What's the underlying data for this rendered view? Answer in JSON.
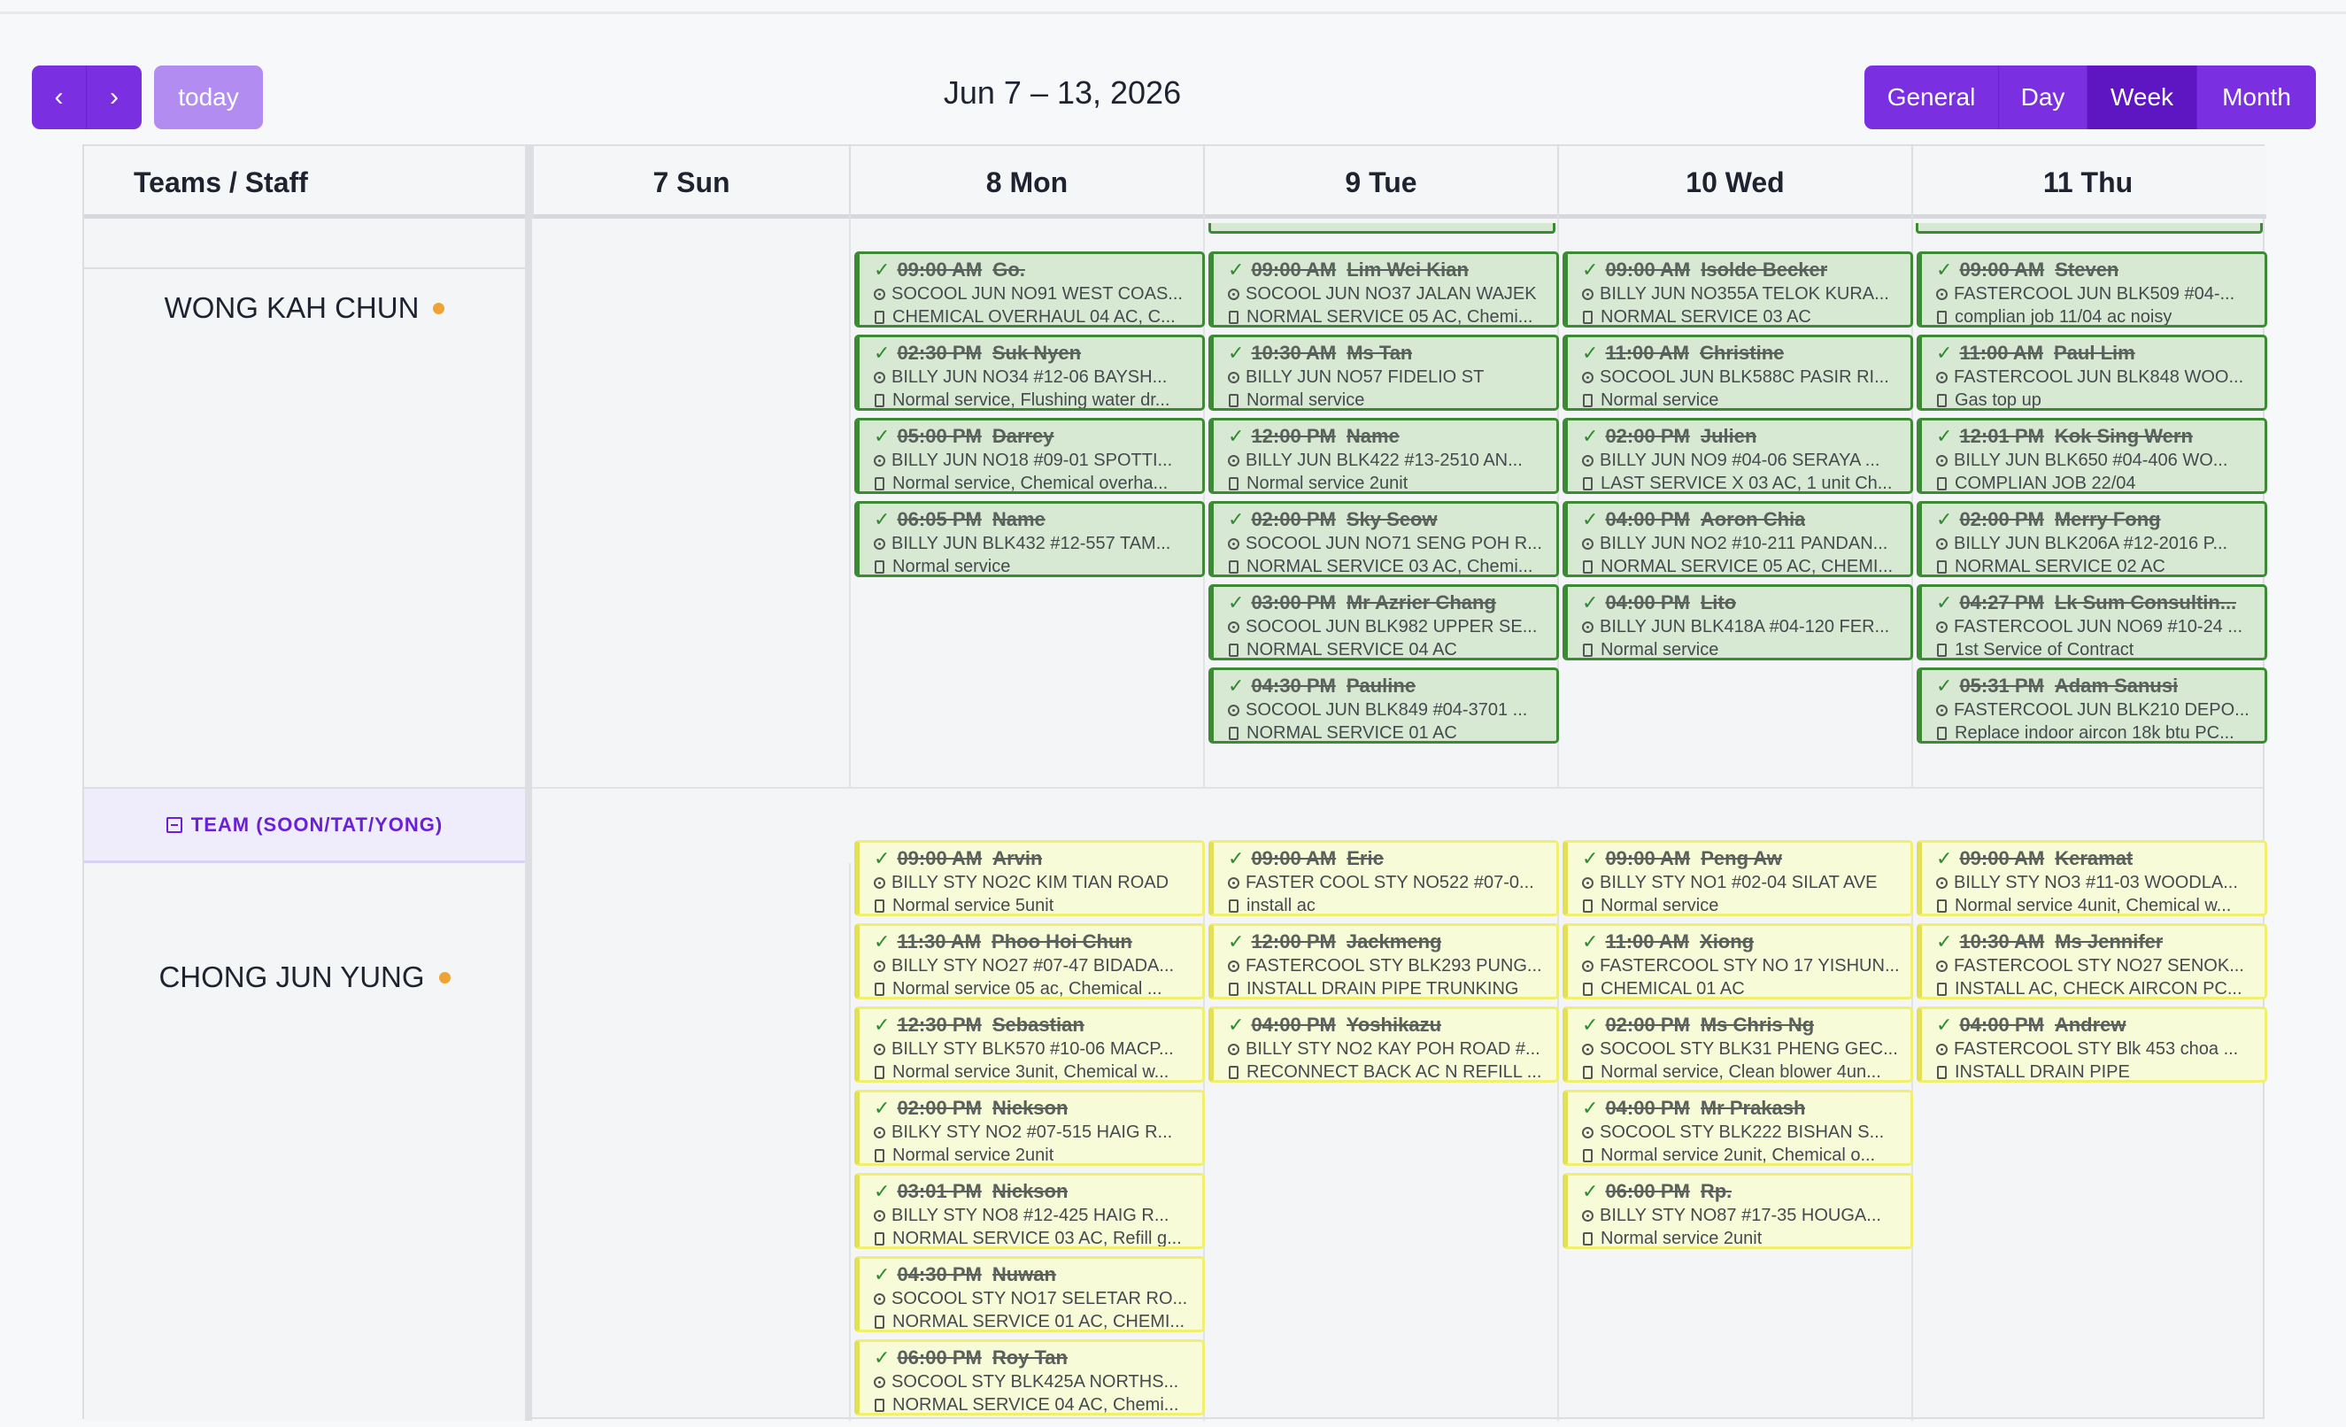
{
  "toolbar": {
    "prev_label": "‹",
    "next_label": "›",
    "today_label": "today",
    "range_title": "Jun 7 – 13, 2026",
    "views": [
      {
        "label": "General",
        "active": false
      },
      {
        "label": "Day",
        "active": false
      },
      {
        "label": "Week",
        "active": true
      },
      {
        "label": "Month",
        "active": false
      }
    ]
  },
  "calendar": {
    "resource_header": "Teams / Staff",
    "days": [
      {
        "label": "7 Sun"
      },
      {
        "label": "8 Mon"
      },
      {
        "label": "9 Tue"
      },
      {
        "label": "10 Wed"
      },
      {
        "label": "11 Thu"
      }
    ],
    "team_label": "TEAM (SOON/TAT/YONG)",
    "staff": [
      {
        "name": "WONG KAH CHUN",
        "status_color": "#eda336",
        "event_color": "green",
        "columns": [
          [],
          [
            {
              "time": "09:00 AM",
              "name": "Go.",
              "address": "SOCOOL JUN NO91 WEST COAS...",
              "note": "CHEMICAL OVERHAUL 04 AC, C..."
            },
            {
              "time": "02:30 PM",
              "name": "Suk Nyen",
              "address": "BILLY JUN NO34 #12-06 BAYSH...",
              "note": "Normal service, Flushing water dr..."
            },
            {
              "time": "05:00 PM",
              "name": "Darrey",
              "address": "BILLY JUN NO18 #09-01 SPOTTI...",
              "note": "Normal service, Chemical overha..."
            },
            {
              "time": "06:05 PM",
              "name": "Name",
              "address": "BILLY JUN BLK432 #12-557 TAM...",
              "note": "Normal service"
            }
          ],
          [
            {
              "time": "09:00 AM",
              "name": "Lim Wei Kian",
              "address": "SOCOOL JUN NO37 JALAN WAJEK",
              "note": "NORMAL SERVICE 05 AC, Chemi..."
            },
            {
              "time": "10:30 AM",
              "name": "Ms Tan",
              "address": "BILLY JUN NO57 FIDELIO ST",
              "note": "Normal service"
            },
            {
              "time": "12:00 PM",
              "name": "Name",
              "address": "BILLY JUN BLK422 #13-2510 AN...",
              "note": "Normal service 2unit"
            },
            {
              "time": "02:00 PM",
              "name": "Sky Seow",
              "address": "SOCOOL JUN NO71 SENG POH R...",
              "note": "NORMAL SERVICE 03 AC, Chemi..."
            },
            {
              "time": "03:00 PM",
              "name": "Mr Azrier Chang",
              "address": "SOCOOL JUN BLK982 UPPER SE...",
              "note": "NORMAL SERVICE 04 AC"
            },
            {
              "time": "04:30 PM",
              "name": "Pauline",
              "address": "SOCOOL JUN BLK849 #04-3701 ...",
              "note": "NORMAL SERVICE 01 AC"
            }
          ],
          [
            {
              "time": "09:00 AM",
              "name": "Isolde Becker",
              "address": "BILLY JUN NO355A TELOK KURA...",
              "note": "NORMAL SERVICE 03 AC"
            },
            {
              "time": "11:00 AM",
              "name": "Christine",
              "address": "SOCOOL JUN BLK588C PASIR RI...",
              "note": "Normal service"
            },
            {
              "time": "02:00 PM",
              "name": "Julien",
              "address": "BILLY JUN NO9 #04-06 SERAYA ...",
              "note": "LAST SERVICE X 03 AC, 1 unit Ch..."
            },
            {
              "time": "04:00 PM",
              "name": "Aoron Chia",
              "address": "BILLY JUN NO2 #10-211 PANDAN...",
              "note": "NORMAL SERVICE 05 AC, CHEMI..."
            },
            {
              "time": "04:00 PM",
              "name": "Lito",
              "address": "BILLY JUN BLK418A #04-120 FER...",
              "note": "Normal service"
            }
          ],
          [
            {
              "time": "09:00 AM",
              "name": "Steven",
              "address": "FASTERCOOL JUN BLK509 #04-...",
              "note": "complian job 11/04 ac noisy"
            },
            {
              "time": "11:00 AM",
              "name": "Paul Lim",
              "address": "FASTERCOOL JUN BLK848 WOO...",
              "note": "Gas top up"
            },
            {
              "time": "12:01 PM",
              "name": "Kok Sing Wern",
              "address": "BILLY JUN BLK650 #04-406 WO...",
              "note": "COMPLIAN JOB 22/04"
            },
            {
              "time": "02:00 PM",
              "name": "Merry Fong",
              "address": "BILLY JUN BLK206A #12-2016 P...",
              "note": "NORMAL SERVICE 02 AC"
            },
            {
              "time": "04:27 PM",
              "name": "Lk Sum Consultin...",
              "address": "FASTERCOOL JUN NO69 #10-24 ...",
              "note": "1st Service of Contract"
            },
            {
              "time": "05:31 PM",
              "name": "Adam Sanusi",
              "address": "FASTERCOOL JUN BLK210 DEPO...",
              "note": "Replace indoor aircon 18k btu PC..."
            }
          ]
        ]
      },
      {
        "name": "CHONG JUN YUNG",
        "status_color": "#eda336",
        "event_color": "yellow",
        "columns": [
          [],
          [
            {
              "time": "09:00 AM",
              "name": "Arvin",
              "address": "BILLY STY NO2C KIM TIAN ROAD",
              "note": "Normal service 5unit"
            },
            {
              "time": "11:30 AM",
              "name": "Phoo Hoi Chun",
              "address": "BILLY STY NO27 #07-47 BIDADA...",
              "note": "Normal service 05 ac, Chemical ..."
            },
            {
              "time": "12:30 PM",
              "name": "Sebastian",
              "address": "BILLY STY BLK570 #10-06 MACP...",
              "note": "Normal service 3unit, Chemical w..."
            },
            {
              "time": "02:00 PM",
              "name": "Nickson",
              "address": "BILKY STY NO2 #07-515 HAIG R...",
              "note": "Normal service 2unit"
            },
            {
              "time": "03:01 PM",
              "name": "Nickson",
              "address": "BILLY STY NO8 #12-425 HAIG R...",
              "note": "NORMAL SERVICE 03 AC, Refill g..."
            },
            {
              "time": "04:30 PM",
              "name": "Nuwan",
              "address": "SOCOOL STY NO17 SELETAR RO...",
              "note": "NORMAL SERVICE 01 AC, CHEMI..."
            },
            {
              "time": "06:00 PM",
              "name": "Roy Tan",
              "address": "SOCOOL STY BLK425A NORTHS...",
              "note": "NORMAL SERVICE 04 AC, Chemi..."
            }
          ],
          [
            {
              "time": "09:00 AM",
              "name": "Eric",
              "address": "FASTER COOL STY NO522 #07-0...",
              "note": "install ac"
            },
            {
              "time": "12:00 PM",
              "name": "Jackmeng",
              "address": "FASTERCOOL STY BLK293 PUNG...",
              "note": "INSTALL DRAIN PIPE TRUNKING"
            },
            {
              "time": "04:00 PM",
              "name": "Yoshikazu",
              "address": "BILLY STY NO2 KAY POH ROAD #...",
              "note": "RECONNECT BACK AC N REFILL ..."
            }
          ],
          [
            {
              "time": "09:00 AM",
              "name": "Peng Aw",
              "address": "BILLY STY NO1 #02-04 SILAT AVE",
              "note": "Normal service"
            },
            {
              "time": "11:00 AM",
              "name": "Xiong",
              "address": "FASTERCOOL STY NO 17 YISHUN...",
              "note": "CHEMICAL 01 AC"
            },
            {
              "time": "02:00 PM",
              "name": "Ms Chris Ng",
              "address": "SOCOOL STY BLK31 PHENG GEC...",
              "note": "Normal service, Clean blower 4un..."
            },
            {
              "time": "04:00 PM",
              "name": "Mr Prakash",
              "address": "SOCOOL STY BLK222 BISHAN S...",
              "note": "Normal service 2unit, Chemical o..."
            },
            {
              "time": "06:00 PM",
              "name": "Rp.",
              "address": "BILLY STY NO87 #17-35 HOUGA...",
              "note": "Normal service 2unit"
            }
          ],
          [
            {
              "time": "09:00 AM",
              "name": "Keramat",
              "address": "BILLY STY NO3 #11-03 WOODLA...",
              "note": "Normal service 4unit, Chemical w..."
            },
            {
              "time": "10:30 AM",
              "name": "Ms Jennifer",
              "address": "FASTERCOOL STY NO27 SENOK...",
              "note": "INSTALL AC, CHECK AIRCON PC..."
            },
            {
              "time": "04:00 PM",
              "name": "Andrew",
              "address": "FASTERCOOL STY Blk 453 choa ...",
              "note": "INSTALL DRAIN PIPE"
            }
          ]
        ]
      }
    ]
  }
}
